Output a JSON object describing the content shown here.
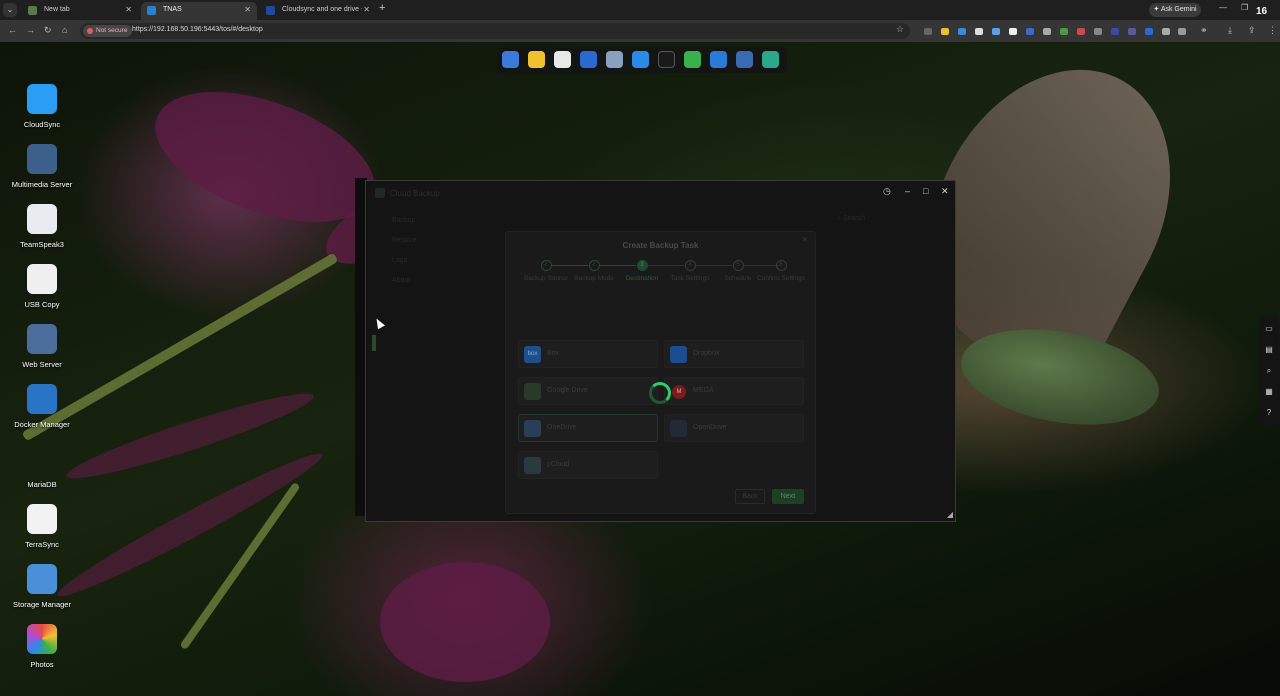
{
  "browser": {
    "tabs": [
      {
        "label": "New tab"
      },
      {
        "label": "TNAS"
      },
      {
        "label": "Cloudsync and one drive - Terra..."
      }
    ],
    "ask_gemini": "Ask Gemini",
    "time": "16",
    "not_secure": "Not secure",
    "url": "https://192.168.50.196:5443/tos/#/desktop"
  },
  "desktop_icons": [
    {
      "label": "CloudSync",
      "color": "#2a9df4"
    },
    {
      "label": "Multimedia Server",
      "color": "#3d5f8c"
    },
    {
      "label": "TeamSpeak3",
      "color": "#e8ecf0"
    },
    {
      "label": "USB Copy",
      "color": "#f0f0f0"
    },
    {
      "label": "Web Server",
      "color": "#4a6d9c"
    },
    {
      "label": "Docker Manager",
      "color": "#2a74c6"
    },
    {
      "label": "MariaDB",
      "color": "#3a1a1a"
    },
    {
      "label": "TerraSync",
      "color": "#f2f2f2"
    },
    {
      "label": "Storage Manager",
      "color": "#4a90d9"
    },
    {
      "label": "Photos",
      "color": "#ffffff"
    }
  ],
  "window": {
    "title": "Cloud Backup",
    "nav": [
      "Backup",
      "Restore",
      "Logs",
      "About"
    ],
    "search_placeholder": "Search"
  },
  "modal": {
    "title": "Create Backup Task",
    "steps": [
      {
        "num": "✓",
        "label": "Backup Source",
        "state": "done"
      },
      {
        "num": "✓",
        "label": "Backup Mode",
        "state": "done"
      },
      {
        "num": "3",
        "label": "Destination",
        "state": "current"
      },
      {
        "num": "4",
        "label": "Task Settings",
        "state": "pending"
      },
      {
        "num": "5",
        "label": "Schedule",
        "state": "pending"
      },
      {
        "num": "6",
        "label": "Confirm Settings",
        "state": "pending"
      }
    ],
    "destinations": [
      {
        "name": "Box",
        "color": "#1f4f8a",
        "logo_text": "box"
      },
      {
        "name": "Dropbox",
        "color": "#1d4d8f",
        "logo_text": ""
      },
      {
        "name": "Google Drive",
        "color": "#2a3a2a",
        "logo_text": ""
      },
      {
        "name": "MEGA",
        "color": "#7a1c1c",
        "logo_text": "M"
      },
      {
        "name": "OneDrive",
        "color": "#2a3f55",
        "logo_text": ""
      },
      {
        "name": "OpenDrive",
        "color": "#222a36",
        "logo_text": ""
      },
      {
        "name": "pCloud",
        "color": "#2a3a3e",
        "logo_text": ""
      }
    ],
    "back_label": "Back",
    "next_label": "Next"
  }
}
